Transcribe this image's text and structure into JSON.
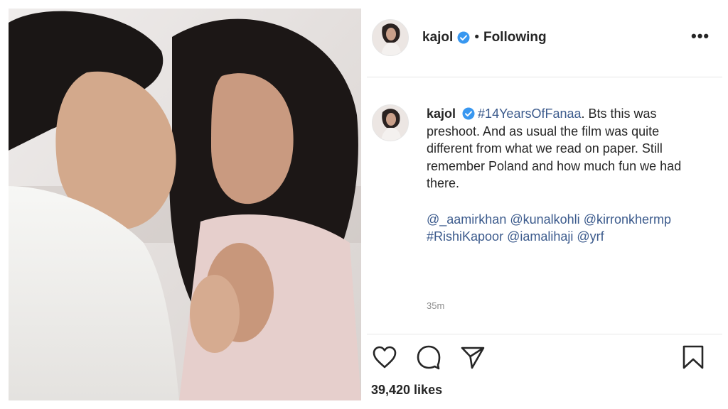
{
  "post": {
    "username": "kajol",
    "separator": "•",
    "follow_status": "Following",
    "more_label": "•••",
    "caption": {
      "hashtag_main": "#14YearsOfFanaa",
      "text": ". Bts this was preshoot. And as usual the film was quite different from what we read on paper. Still remember Poland and how much fun we had there.",
      "mentions": [
        "@_aamirkhan",
        "@kunalkohli",
        "@kirronkhermp",
        "#RishiKapoor",
        "@iamalihaji",
        "@yrf"
      ]
    },
    "time_ago": "35m",
    "likes": "39,420 likes"
  },
  "icons": {
    "like": "heart-icon",
    "comment": "comment-bubble-icon",
    "share": "paper-plane-icon",
    "save": "bookmark-icon",
    "verified": "verified-badge-icon"
  },
  "colors": {
    "verified_blue": "#3897f0",
    "link_blue": "#3b5a8c",
    "text": "#262626",
    "muted": "#8e8e8e"
  }
}
